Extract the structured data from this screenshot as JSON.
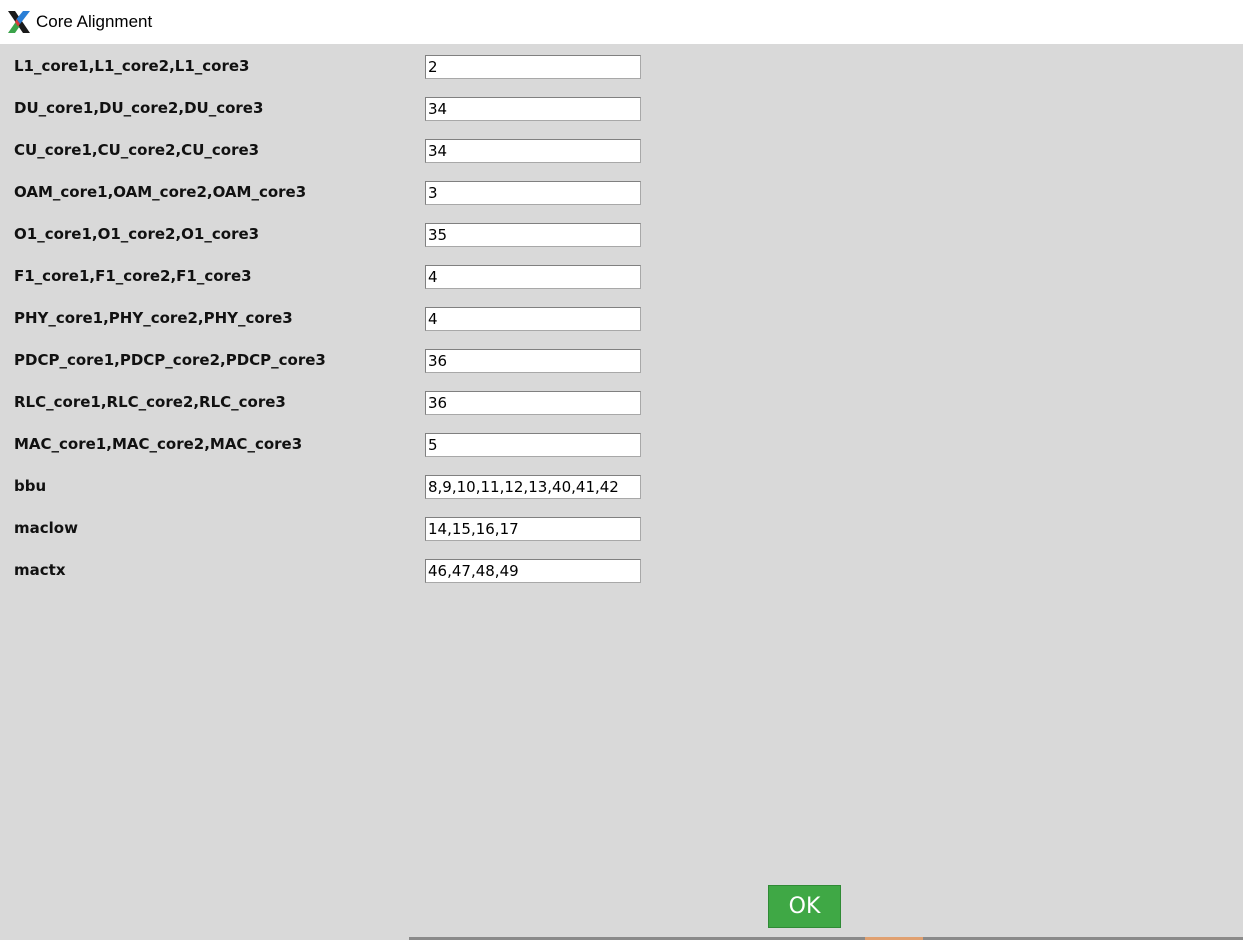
{
  "window": {
    "title": "Core Alignment",
    "icon": "x-app-icon"
  },
  "fields": [
    {
      "label": "L1_core1,L1_core2,L1_core3",
      "value": "2"
    },
    {
      "label": "DU_core1,DU_core2,DU_core3",
      "value": "34"
    },
    {
      "label": "CU_core1,CU_core2,CU_core3",
      "value": "34"
    },
    {
      "label": "OAM_core1,OAM_core2,OAM_core3",
      "value": "3"
    },
    {
      "label": "O1_core1,O1_core2,O1_core3",
      "value": "35"
    },
    {
      "label": "F1_core1,F1_core2,F1_core3",
      "value": "4"
    },
    {
      "label": "PHY_core1,PHY_core2,PHY_core3",
      "value": "4"
    },
    {
      "label": "PDCP_core1,PDCP_core2,PDCP_core3",
      "value": "36"
    },
    {
      "label": "RLC_core1,RLC_core2,RLC_core3",
      "value": "36"
    },
    {
      "label": "MAC_core1,MAC_core2,MAC_core3",
      "value": "5"
    },
    {
      "label": "bbu",
      "value": "8,9,10,11,12,13,40,41,42"
    },
    {
      "label": "maclow",
      "value": "14,15,16,17"
    },
    {
      "label": "mactx",
      "value": "46,47,48,49"
    }
  ],
  "actions": {
    "ok_label": "OK"
  },
  "colors": {
    "background": "#d9d9d9",
    "ok_button": "#3fa845"
  }
}
